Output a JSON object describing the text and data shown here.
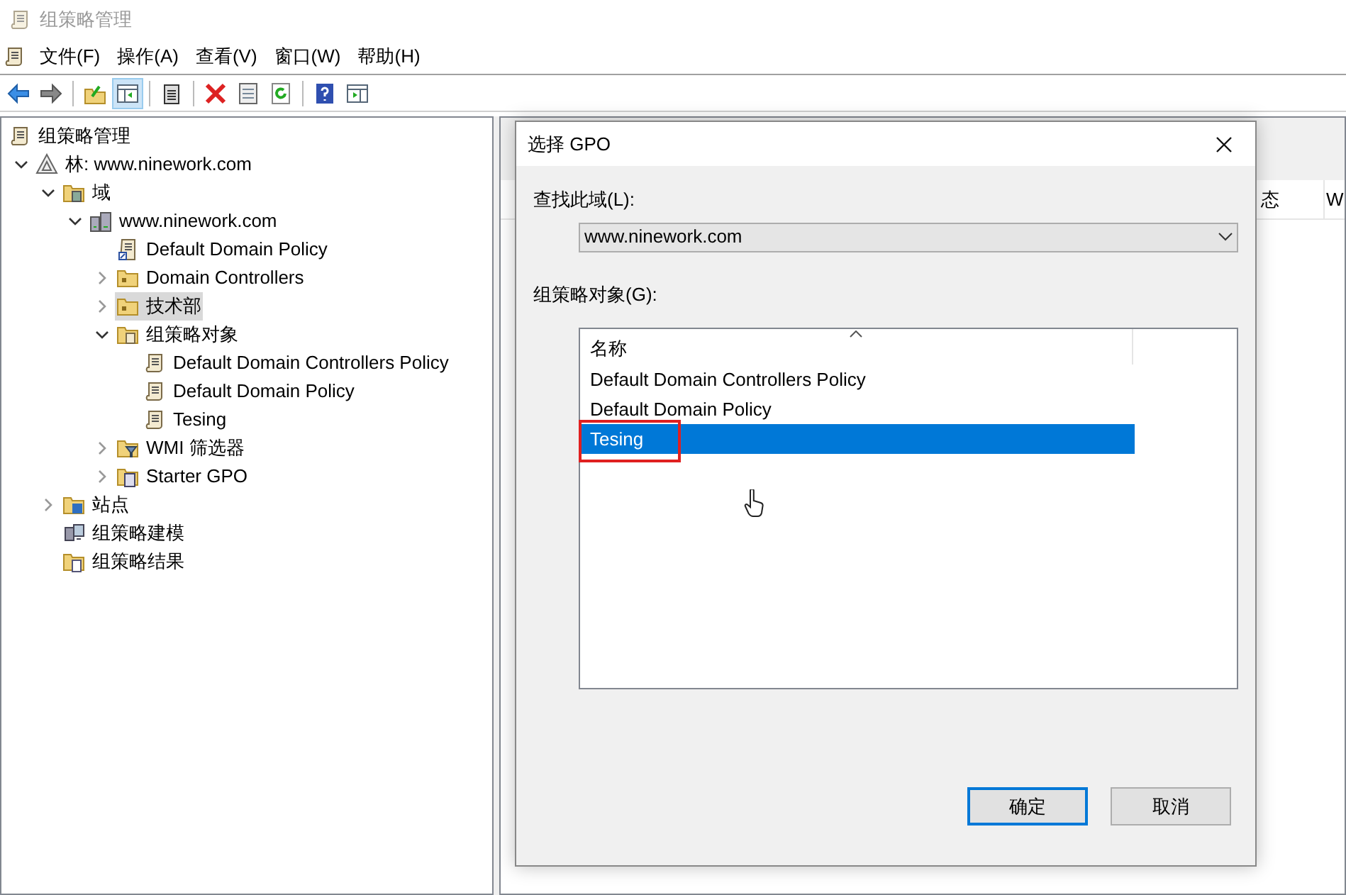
{
  "window": {
    "title": "组策略管理"
  },
  "menu": [
    {
      "label": "文件(F)"
    },
    {
      "label": "操作(A)"
    },
    {
      "label": "查看(V)"
    },
    {
      "label": "窗口(W)"
    },
    {
      "label": "帮助(H)"
    }
  ],
  "toolbar": [
    {
      "kind": "back",
      "pressed": false
    },
    {
      "kind": "forward",
      "pressed": false
    },
    {
      "kind": "sep"
    },
    {
      "kind": "up",
      "pressed": false
    },
    {
      "kind": "tree",
      "pressed": true
    },
    {
      "kind": "sep"
    },
    {
      "kind": "clipboard",
      "pressed": false
    },
    {
      "kind": "sep"
    },
    {
      "kind": "delete",
      "pressed": false
    },
    {
      "kind": "properties",
      "pressed": false
    },
    {
      "kind": "refresh",
      "pressed": false
    },
    {
      "kind": "sep"
    },
    {
      "kind": "help",
      "pressed": false
    },
    {
      "kind": "pane",
      "pressed": false
    }
  ],
  "tree": [
    {
      "label": "组策略管理",
      "kind": "console",
      "selected": false,
      "children": [
        {
          "label": "林: www.ninework.com",
          "kind": "forest",
          "selected": false,
          "expanded": true,
          "children": [
            {
              "label": "域",
              "kind": "domains",
              "selected": false,
              "expanded": true,
              "children": [
                {
                  "label": "www.ninework.com",
                  "kind": "domain",
                  "selected": false,
                  "expanded": true,
                  "children": [
                    {
                      "label": "Default Domain Policy",
                      "kind": "link",
                      "selected": false
                    },
                    {
                      "label": "Domain Controllers",
                      "kind": "ou",
                      "selected": false,
                      "expanded": false
                    },
                    {
                      "label": "技术部",
                      "kind": "ou",
                      "selected": true,
                      "expanded": false
                    },
                    {
                      "label": "组策略对象",
                      "kind": "gpofolder",
                      "selected": false,
                      "expanded": true,
                      "children": [
                        {
                          "label": "Default Domain Controllers Policy",
                          "kind": "gpo",
                          "selected": false
                        },
                        {
                          "label": "Default Domain Policy",
                          "kind": "gpo",
                          "selected": false
                        },
                        {
                          "label": "Tesing",
                          "kind": "gpo",
                          "selected": false
                        }
                      ]
                    },
                    {
                      "label": "WMI 筛选器",
                      "kind": "wmi",
                      "selected": false,
                      "expanded": false
                    },
                    {
                      "label": "Starter GPO",
                      "kind": "starter",
                      "selected": false,
                      "expanded": false
                    }
                  ]
                }
              ]
            },
            {
              "label": "站点",
              "kind": "sites",
              "selected": false,
              "expanded": false
            },
            {
              "label": "组策略建模",
              "kind": "modeling",
              "selected": false
            },
            {
              "label": "组策略结果",
              "kind": "results",
              "selected": false
            }
          ]
        }
      ]
    }
  ],
  "right_pane": {
    "columns": [
      {
        "label": "态"
      },
      {
        "label": "W"
      }
    ]
  },
  "dialog": {
    "title": "选择 GPO",
    "domain_label": "查找此域(L):",
    "domain_value": "www.ninework.com",
    "list_label": "组策略对象(G):",
    "column": "名称",
    "rows": [
      {
        "label": "Default Domain Controllers Policy",
        "selected": false,
        "annotated": false
      },
      {
        "label": "Default Domain Policy",
        "selected": false,
        "annotated": false
      },
      {
        "label": "Tesing",
        "selected": true,
        "annotated": true
      }
    ],
    "buttons": [
      {
        "label": "确定",
        "default": true
      },
      {
        "label": "取消",
        "default": false
      }
    ]
  }
}
